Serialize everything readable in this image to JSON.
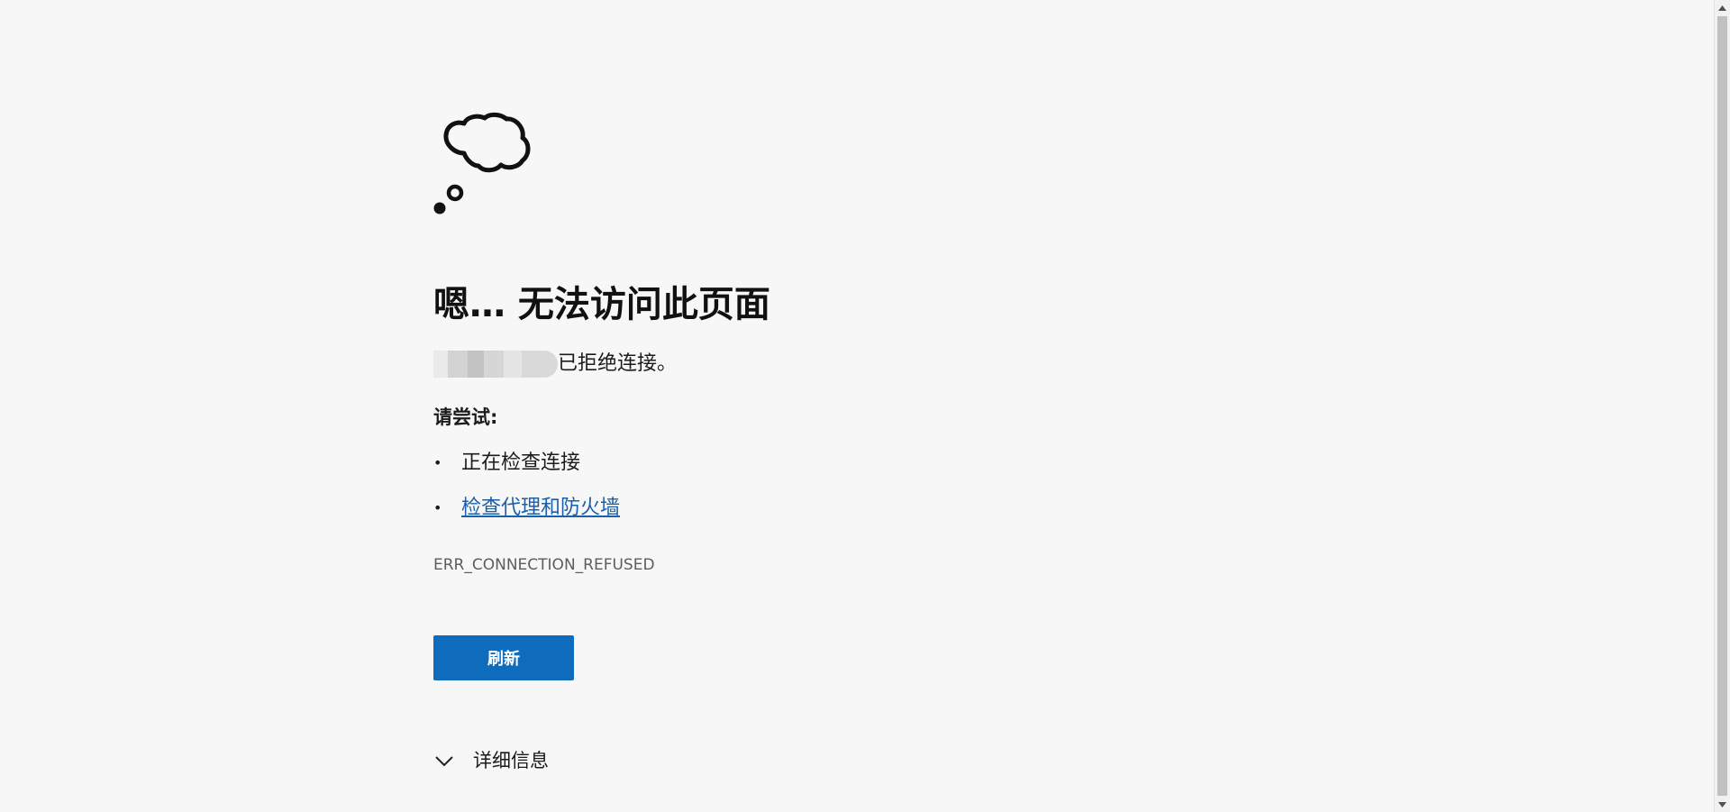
{
  "error_page": {
    "icon": "thought-cloud-icon",
    "title": "嗯… 无法访问此页面",
    "refused_suffix": "已拒绝连接。",
    "try_heading": "请尝试:",
    "suggestions": [
      {
        "text": "正在检查连接",
        "is_link": false
      },
      {
        "text": "检查代理和防火墙",
        "is_link": true
      }
    ],
    "error_code": "ERR_CONNECTION_REFUSED",
    "refresh_label": "刷新",
    "details_label": "详细信息",
    "details_icon": "chevron-down-icon"
  },
  "colors": {
    "background": "#f7f7f7",
    "button": "#0f6cbd",
    "link": "#1a5fa8",
    "error_code": "#5d5d5d"
  }
}
